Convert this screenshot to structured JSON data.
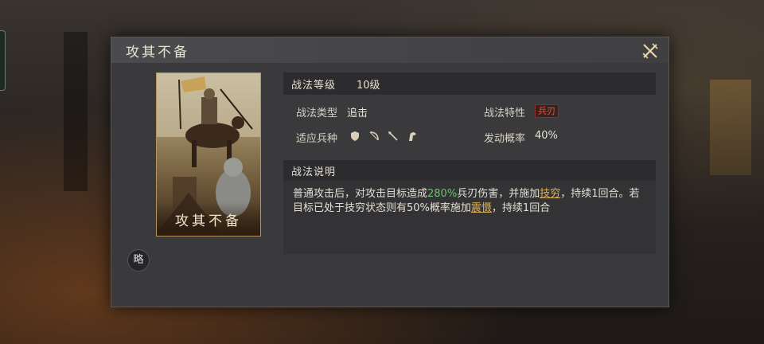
{
  "dialog": {
    "title": "攻其不备",
    "card_name": "攻其不备",
    "brief_button": "略"
  },
  "level": {
    "label": "战法等级",
    "value": "10级"
  },
  "info": {
    "type_label": "战法类型",
    "type_value": "追击",
    "trait_label": "战法特性",
    "trait_value": "兵刃",
    "troop_label": "适应兵种",
    "troop_icons": [
      "shield-icon",
      "bow-icon",
      "spear-icon",
      "horse-icon"
    ],
    "rate_label": "发动概率",
    "rate_value": "40%"
  },
  "description": {
    "label": "战法说明",
    "text_1": "普通攻击后，对攻击目标造成",
    "damage_pct": "280%",
    "text_2": "兵刃伤害，并施加",
    "status_1": "技穷",
    "text_3": "，持续1回合。若目标已处于技穷状态则有50%概率施加",
    "status_2": "震慑",
    "text_4": "，持续1回合"
  },
  "colors": {
    "highlight_green": "#6cc26a",
    "highlight_gold": "#e0b25a",
    "trait_red": "#d35a4a"
  }
}
